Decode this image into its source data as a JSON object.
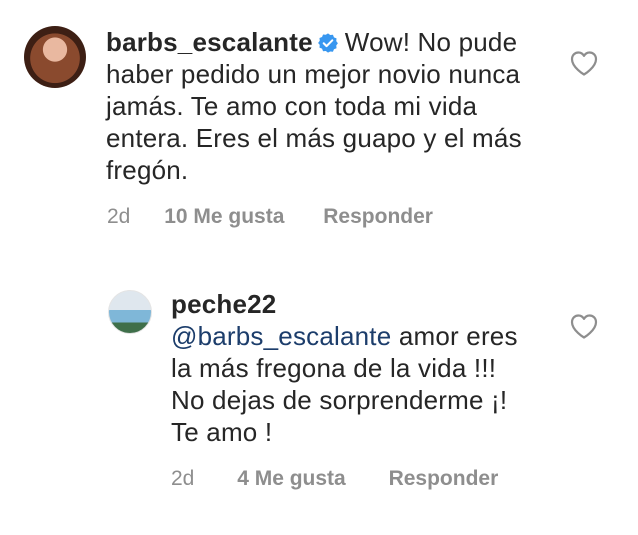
{
  "comments": [
    {
      "username": "barbs_escalante",
      "verified": true,
      "body": "Wow! No pude haber pedido un mejor novio nunca jamás. Te amo con toda mi vida entera. Eres el más guapo y el más fregón.",
      "time": "2d",
      "likes": "10 Me gusta",
      "reply": "Responder",
      "icons": {
        "avatar": "profile-photo",
        "like": "heart-outline-icon",
        "verified": "verified-badge-icon"
      }
    },
    {
      "username": "peche22",
      "mention": "@barbs_escalante",
      "body": " amor eres la más fregona de la vida !!! No dejas de sorprenderme ¡! Te amo !",
      "time": "2d",
      "likes": "4 Me gusta",
      "reply": "Responder",
      "icons": {
        "avatar": "profile-photo",
        "like": "heart-outline-icon"
      }
    }
  ],
  "colors": {
    "text": "#262626",
    "meta": "#8e8e8e",
    "mention": "#1c3d6b",
    "verified": "#3897f0"
  }
}
